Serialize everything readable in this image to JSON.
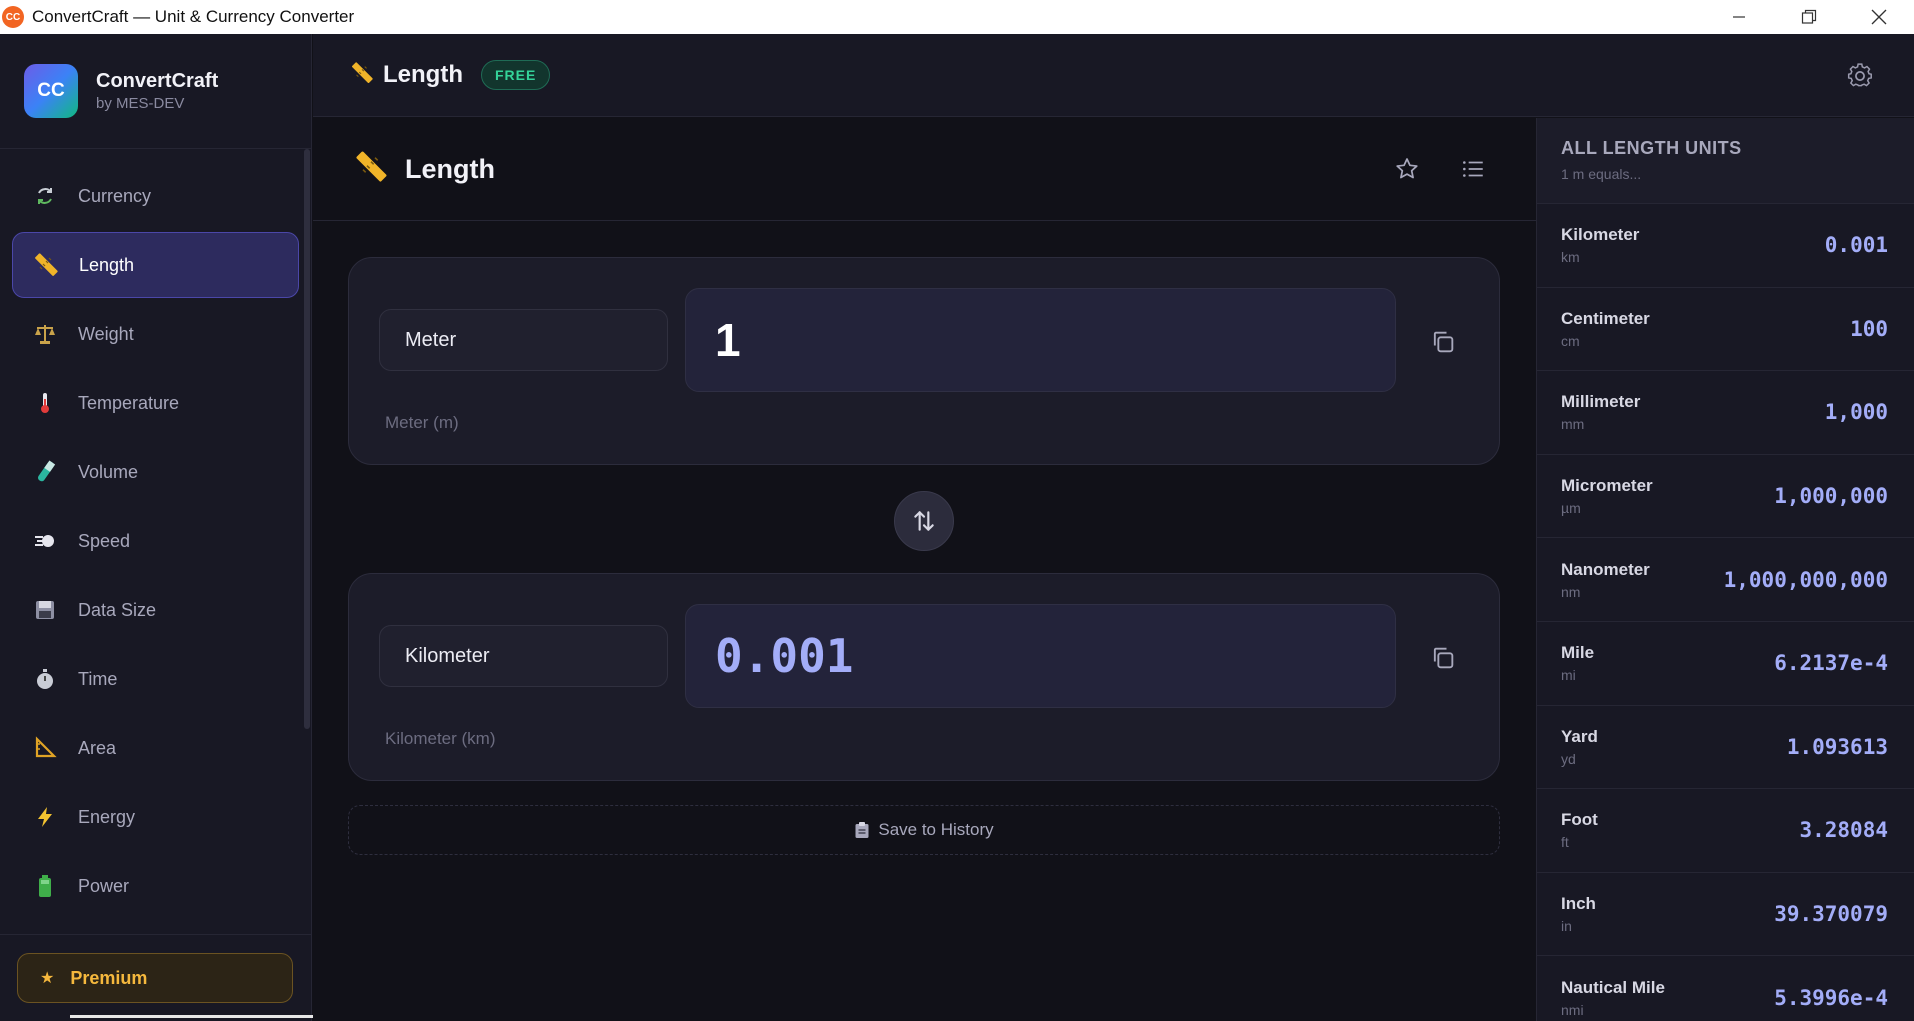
{
  "window": {
    "title": "ConvertCraft — Unit & Currency Converter",
    "icon_text": "CC"
  },
  "brand": {
    "logo_text": "CC",
    "name": "ConvertCraft",
    "subtitle": "by MES-DEV"
  },
  "sidebar": {
    "items": [
      {
        "label": "Currency",
        "icon": "currency-exchange-icon"
      },
      {
        "label": "Length",
        "icon": "ruler-icon",
        "active": true
      },
      {
        "label": "Weight",
        "icon": "scales-icon"
      },
      {
        "label": "Temperature",
        "icon": "thermometer-icon"
      },
      {
        "label": "Volume",
        "icon": "test-tube-icon"
      },
      {
        "label": "Speed",
        "icon": "dash-icon"
      },
      {
        "label": "Data Size",
        "icon": "floppy-disk-icon"
      },
      {
        "label": "Time",
        "icon": "stopwatch-icon"
      },
      {
        "label": "Area",
        "icon": "triangle-ruler-icon"
      },
      {
        "label": "Energy",
        "icon": "lightning-icon"
      },
      {
        "label": "Power",
        "icon": "battery-icon"
      }
    ],
    "premium_label": "Premium"
  },
  "header": {
    "title": "Length",
    "badge": "FREE"
  },
  "main": {
    "title": "Length",
    "from": {
      "unit": "Meter",
      "value": "1",
      "caption": "Meter (m)"
    },
    "to": {
      "unit": "Kilometer",
      "value": "0.001",
      "caption": "Kilometer (km)"
    },
    "save_history_label": "Save to History"
  },
  "panel": {
    "title": "ALL LENGTH UNITS",
    "subtitle": "1 m equals...",
    "units": [
      {
        "name": "Kilometer",
        "abbr": "km",
        "value": "0.001"
      },
      {
        "name": "Centimeter",
        "abbr": "cm",
        "value": "100"
      },
      {
        "name": "Millimeter",
        "abbr": "mm",
        "value": "1,000"
      },
      {
        "name": "Micrometer",
        "abbr": "µm",
        "value": "1,000,000"
      },
      {
        "name": "Nanometer",
        "abbr": "nm",
        "value": "1,000,000,000"
      },
      {
        "name": "Mile",
        "abbr": "mi",
        "value": "6.2137e-4"
      },
      {
        "name": "Yard",
        "abbr": "yd",
        "value": "1.093613"
      },
      {
        "name": "Foot",
        "abbr": "ft",
        "value": "3.28084"
      },
      {
        "name": "Inch",
        "abbr": "in",
        "value": "39.370079"
      },
      {
        "name": "Nautical Mile",
        "abbr": "nmi",
        "value": "5.3996e-4"
      }
    ]
  },
  "colors": {
    "accent": "#a3adf8",
    "active_nav": "#2d2b5e",
    "free_badge": "#34d399",
    "premium": "#f5b83d"
  }
}
